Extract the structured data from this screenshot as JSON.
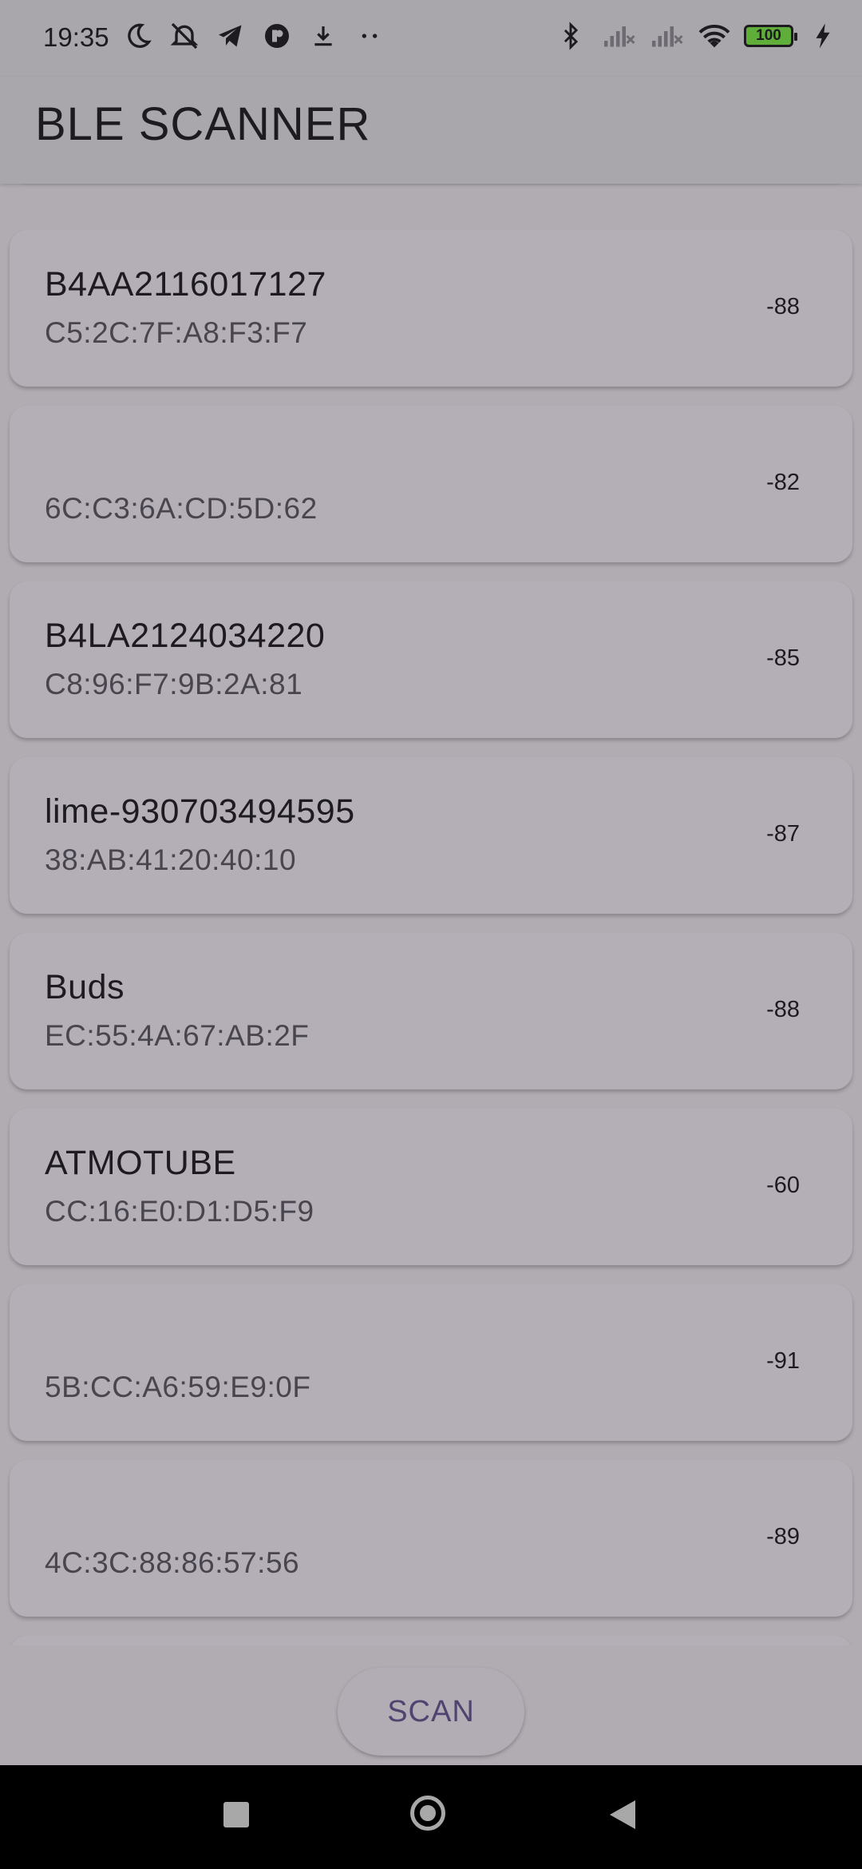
{
  "status_bar": {
    "time": "19:35",
    "left_icons": [
      "moon-icon",
      "mute-icon",
      "telegram-icon",
      "app-icon",
      "download-icon",
      "more-icon"
    ],
    "right_icons": [
      "bluetooth-icon",
      "signal-icon",
      "signal-icon",
      "wifi-icon"
    ],
    "battery": "100",
    "charging_icon": "bolt-icon"
  },
  "app_bar": {
    "title": "BLE SCANNER"
  },
  "devices": [
    {
      "name": "B4AA2116017127",
      "mac": "C5:2C:7F:A8:F3:F7",
      "rssi": "-88"
    },
    {
      "name": "",
      "mac": "6C:C3:6A:CD:5D:62",
      "rssi": "-82"
    },
    {
      "name": "B4LA2124034220",
      "mac": "C8:96:F7:9B:2A:81",
      "rssi": "-85"
    },
    {
      "name": "lime-930703494595",
      "mac": "38:AB:41:20:40:10",
      "rssi": "-87"
    },
    {
      "name": "Buds",
      "mac": "EC:55:4A:67:AB:2F",
      "rssi": "-88"
    },
    {
      "name": "ATMOTUBE",
      "mac": "CC:16:E0:D1:D5:F9",
      "rssi": "-60"
    },
    {
      "name": "",
      "mac": "5B:CC:A6:59:E9:0F",
      "rssi": "-91"
    },
    {
      "name": "",
      "mac": "4C:3C:88:86:57:56",
      "rssi": "-89"
    }
  ],
  "scan_button": {
    "label": "SCAN"
  },
  "colors": {
    "background": "#B0ACB2",
    "card": "#B4AFB6",
    "accent": "#4F4370"
  }
}
